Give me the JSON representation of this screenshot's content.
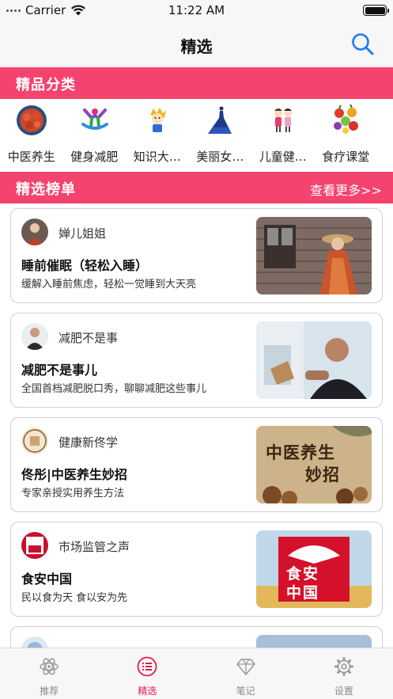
{
  "status_bar": {
    "carrier": "Carrier",
    "time": "11:22 AM"
  },
  "nav": {
    "title": "精选"
  },
  "categories_section": {
    "title": "精品分类",
    "items": [
      {
        "label": "中医养生",
        "icon": "crayfish-icon"
      },
      {
        "label": "健身减肥",
        "icon": "fitness-icon"
      },
      {
        "label": "知识大…",
        "icon": "cartoon-kid-icon"
      },
      {
        "label": "美丽女…",
        "icon": "gown-icon"
      },
      {
        "label": "儿童健…",
        "icon": "children-icon"
      },
      {
        "label": "食疗课堂",
        "icon": "fruits-icon"
      }
    ]
  },
  "ranking_section": {
    "title": "精选榜单",
    "more_label": "查看更多>>",
    "cards": [
      {
        "author": "婵儿姐姐",
        "title": "睡前催眠（轻松入睡）",
        "desc": "缓解入睡前焦虑，轻松一觉睡到大天亮"
      },
      {
        "author": "减肥不是事",
        "title": "减肥不是事儿",
        "desc": "全国首档减肥脱口秀，聊聊减肥这些事儿"
      },
      {
        "author": "健康新佟学",
        "title": "佟彤|中医养生妙招",
        "desc": "专家亲授实用养生方法",
        "thumb_text": [
          "中医养生",
          "妙招"
        ]
      },
      {
        "author": "市场监管之声",
        "title": "食安中国",
        "desc": "民以食为天 食以安为先",
        "thumb_text": [
          "食安",
          "中国"
        ]
      }
    ]
  },
  "tab_bar": {
    "active": "精选",
    "items": [
      {
        "label": "推荐",
        "icon": "atom-icon"
      },
      {
        "label": "精选",
        "icon": "list-icon"
      },
      {
        "label": "笔记",
        "icon": "diamond-icon"
      },
      {
        "label": "设置",
        "icon": "gear-icon"
      }
    ]
  },
  "colors": {
    "accent": "#f4436e",
    "active_tab": "#e5194a",
    "search": "#1a7cf0"
  }
}
